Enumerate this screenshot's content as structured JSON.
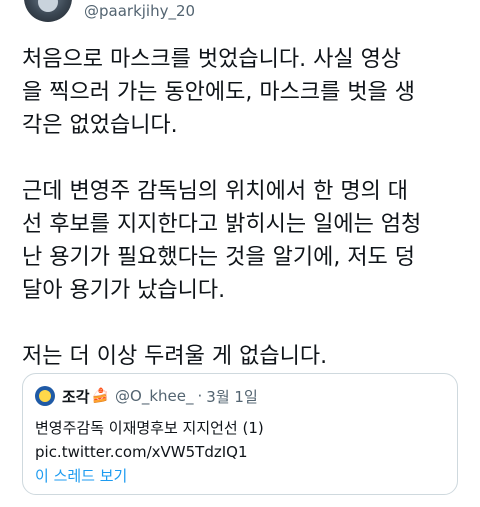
{
  "tweet": {
    "handle": "@paarkjihy_20",
    "text": "처음으로 마스크를 벗었습니다. 사실 영상\n을 찍으러 가는 동안에도, 마스크를 벗을 생\n각은 없었습니다.\n\n근데 변영주 감독님의 위치에서 한 명의 대\n선 후보를 지지한다고 밝히시는 일에는 엄청\n난 용기가 필요했다는 것을 알기에, 저도 덩\n달아 용기가 났습니다.\n\n저는 더 이상 두려울 게 없습니다."
  },
  "quote": {
    "name": "조각",
    "emoji": "🍰",
    "handle": "@O_khee_",
    "separator": "·",
    "date": "3월 1일",
    "text": "변영주감독 이재명후보 지지언선 (1)",
    "url": "pic.twitter.com/xVW5TdzIQ1",
    "thread_link": "이 스레드 보기"
  },
  "colors": {
    "text_primary": "#0f1419",
    "text_secondary": "#536471",
    "link": "#1d9bf0",
    "border": "#cfd9de"
  }
}
